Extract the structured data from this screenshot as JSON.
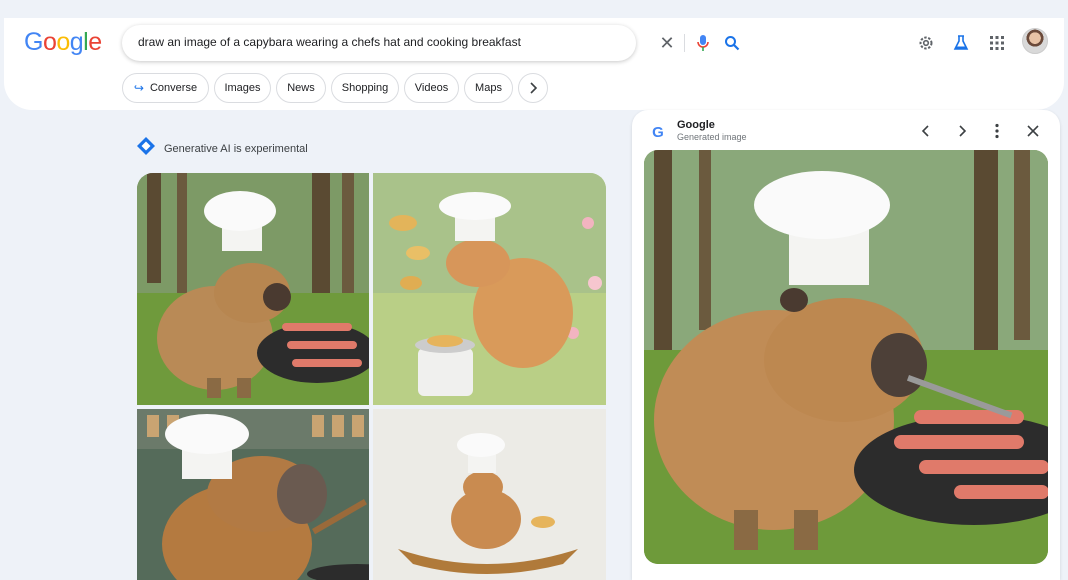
{
  "header": {
    "logo_letters": [
      {
        "char": "G",
        "color": "#4285F4"
      },
      {
        "char": "o",
        "color": "#EA4335"
      },
      {
        "char": "o",
        "color": "#FBBC05"
      },
      {
        "char": "g",
        "color": "#4285F4"
      },
      {
        "char": "l",
        "color": "#34A853"
      },
      {
        "char": "e",
        "color": "#EA4335"
      }
    ],
    "search": {
      "query": "draw an image of a capybara wearing a chefs hat and cooking breakfast",
      "clear_icon": "close-icon",
      "mic_icon": "microphone-icon",
      "search_icon": "search-icon"
    },
    "right_icons": [
      "settings-icon",
      "labs-flask-icon",
      "apps-grid-icon"
    ],
    "avatar_icon": "account-avatar"
  },
  "chips": {
    "converse": "Converse",
    "images": "Images",
    "news": "News",
    "shopping": "Shopping",
    "videos": "Videos",
    "maps": "Maps",
    "more_icon": "chevron-right-icon"
  },
  "ai": {
    "label": "Generative AI is experimental",
    "icon": "gemini-sparkle-icon"
  },
  "panel": {
    "title": "Google",
    "subtitle": "Generated image",
    "icons": [
      "chevron-left-icon",
      "chevron-right-icon",
      "more-vert-icon",
      "close-icon"
    ]
  },
  "colors": {
    "accent": "#1a73e8",
    "background": "#eef2f8"
  }
}
